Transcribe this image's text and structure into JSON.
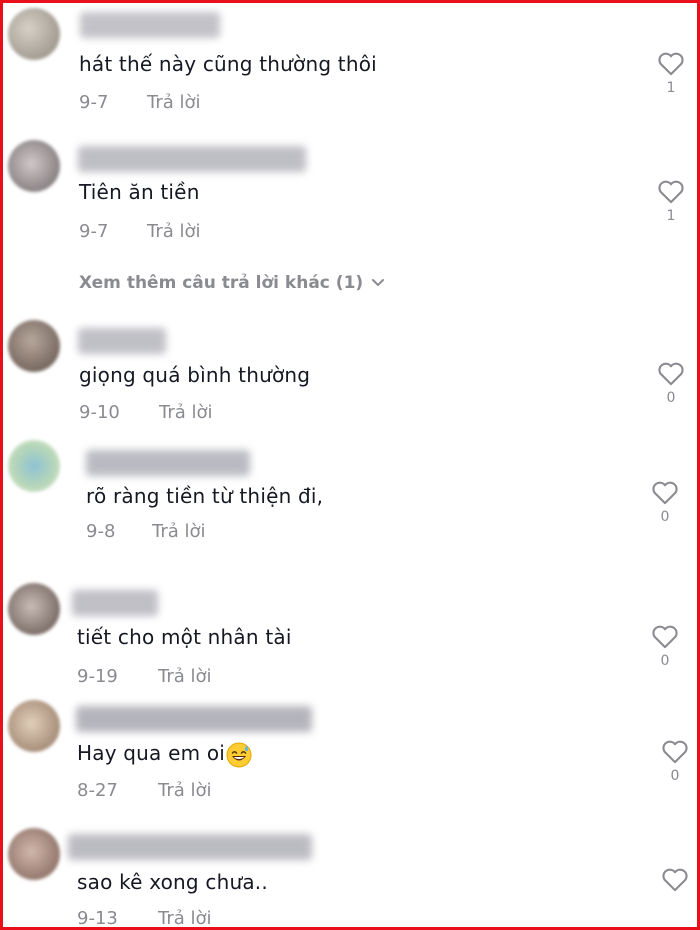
{
  "reply_label": "Trả lời",
  "view_more_replies": "Xem thêm câu trả lời khác (1)",
  "comments": [
    {
      "text": "hát thế này cũng thường thôi",
      "date": "9-7",
      "likes": "1",
      "avatar_color": "#b9b4ad"
    },
    {
      "text": "Tiên ăn tiền",
      "date": "9-7",
      "likes": "1",
      "avatar_color": "#a9a4a6"
    },
    {
      "text": "giọng quá bình thường",
      "date": "9-10",
      "likes": "0",
      "avatar_color": "#8f8077"
    },
    {
      "text": "rõ ràng tiền từ thiện đi,",
      "date": "9-8",
      "likes": "0",
      "avatar_color": "#9fbfaa"
    },
    {
      "text": "tiết cho một nhân tài",
      "date": "9-19",
      "likes": "0",
      "avatar_color": "#9a8f8a"
    },
    {
      "text": "Hay qua em oi",
      "date": "8-27",
      "likes": "0",
      "avatar_color": "#c5b09c",
      "emoji": "grinning-sweat-emoji"
    },
    {
      "text": "sao kê xong chưa..",
      "date": "9-13",
      "likes": "",
      "avatar_color": "#a88e84"
    }
  ],
  "colors": {
    "border": "#e8101b",
    "text": "#161823",
    "muted": "#8a8b91"
  }
}
